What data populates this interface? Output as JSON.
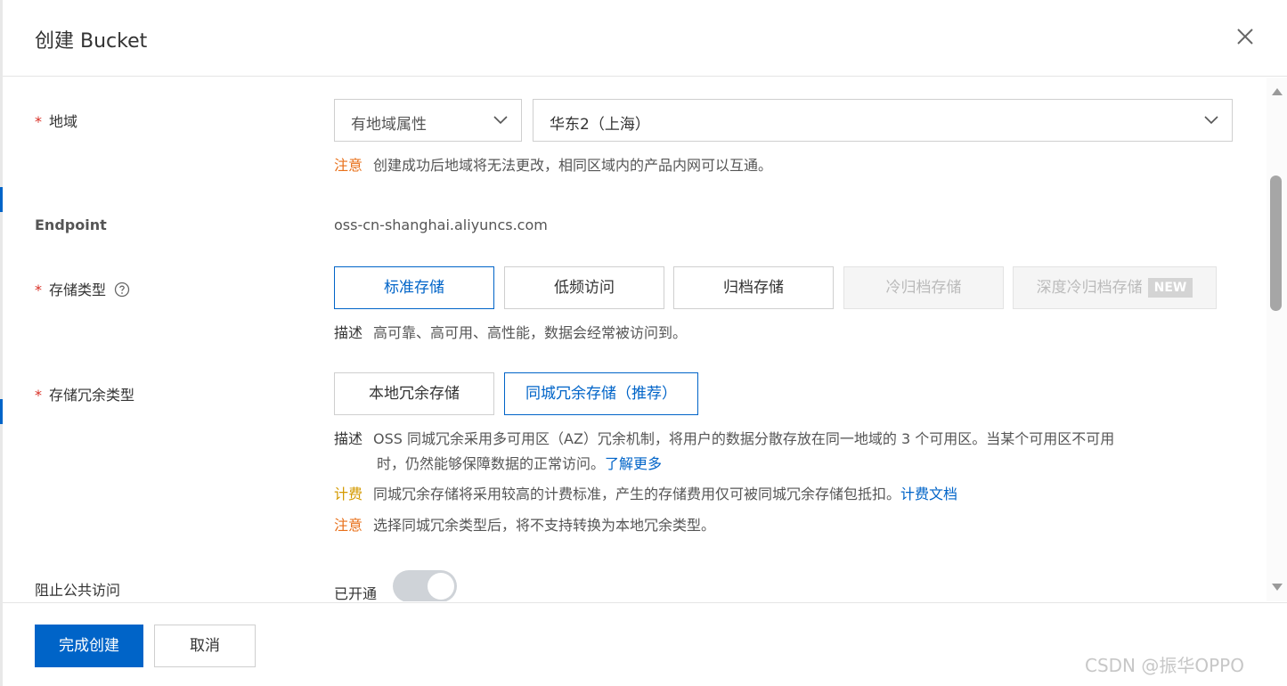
{
  "dialog": {
    "title": "创建 Bucket"
  },
  "region": {
    "label": "地域",
    "attr_select": "有地域属性",
    "region_select": "华东2（上海）",
    "note_tag": "注意",
    "note_text": "创建成功后地域将无法更改，相同区域内的产品内网可以互通。"
  },
  "endpoint": {
    "label": "Endpoint",
    "value": "oss-cn-shanghai.aliyuncs.com"
  },
  "storage_class": {
    "label": "存储类型",
    "options": [
      "标准存储",
      "低频访问",
      "归档存储",
      "冷归档存储",
      "深度冷归档存储"
    ],
    "selected": "标准存储",
    "new_badge": "NEW",
    "desc_tag": "描述",
    "desc_text": "高可靠、高可用、高性能，数据会经常被访问到。"
  },
  "redundancy": {
    "label": "存储冗余类型",
    "options": [
      "本地冗余存储",
      "同城冗余存储（推荐）"
    ],
    "selected": "同城冗余存储（推荐）",
    "desc_tag": "描述",
    "desc_line1": "OSS 同城冗余采用多可用区（AZ）冗余机制，将用户的数据分散存放在同一地域的 3 个可用区。当某个可用区不可用",
    "desc_line2": "时，仍然能够保障数据的正常访问。",
    "learn_more": "了解更多",
    "billing_tag": "计费",
    "billing_text": "同城冗余存储将采用较高的计费标准，产生的存储费用仅可被同城冗余存储包抵扣。",
    "billing_link": "计费文档",
    "notice_tag": "注意",
    "notice_text": "选择同城冗余类型后，将不支持转换为本地冗余类型。"
  },
  "public_access": {
    "label": "阻止公共访问",
    "status": "已开通",
    "enabled": true
  },
  "footer": {
    "confirm": "完成创建",
    "cancel": "取消"
  },
  "watermark": "CSDN @振华OPPO",
  "colors": {
    "primary": "#0064c8",
    "required": "#d93026",
    "warn": "#e8701a",
    "billing": "#d49a00"
  }
}
